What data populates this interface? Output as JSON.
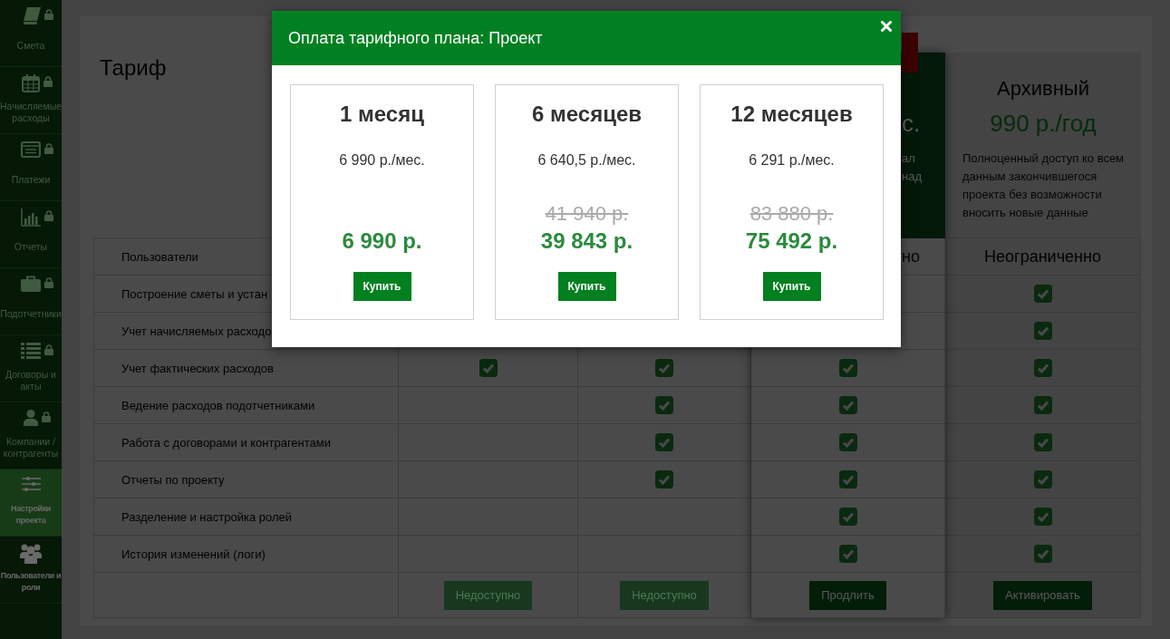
{
  "sidebar": {
    "items": [
      {
        "label": "Смета",
        "locked": true,
        "selected": false
      },
      {
        "label": "Начисляемые расходы",
        "locked": true,
        "selected": false
      },
      {
        "label": "Платежи",
        "locked": true,
        "selected": false
      },
      {
        "label": "Отчеты",
        "locked": true,
        "selected": false
      },
      {
        "label": "Подотчетники",
        "locked": true,
        "selected": false
      },
      {
        "label": "Договоры и акты",
        "locked": true,
        "selected": false
      },
      {
        "label": "Компании / контрагенты",
        "locked": true,
        "selected": false
      },
      {
        "label": "Настройки проекта",
        "locked": false,
        "selected": true
      },
      {
        "label": "Пользователи и роли",
        "locked": false,
        "selected": false
      }
    ]
  },
  "page": {
    "title": "Тариф"
  },
  "tariff_table": {
    "plans": [
      {
        "kind": "regular",
        "button": {
          "label": "Недоступно",
          "disabled": true
        }
      },
      {
        "kind": "regular",
        "button": {
          "label": "Недоступно",
          "disabled": true
        }
      },
      {
        "kind": "current",
        "header": {
          "price": "с.",
          "description_lines": [
            "ал",
            "над"
          ]
        },
        "button": {
          "label": "Продлить",
          "disabled": false
        }
      },
      {
        "kind": "archive",
        "header": {
          "name": "Архивный",
          "price": "990 р./год",
          "description": "Полноценный доступ ко всем данным закончившегося проекта без возможности вносить новые данные"
        },
        "button": {
          "label": "Активировать",
          "disabled": false
        }
      }
    ],
    "rows": [
      {
        "feature": "Пользователи",
        "cells": [
          null,
          null,
          {
            "kind": "text",
            "text": "но"
          },
          {
            "kind": "text",
            "text": "Неограниченно"
          }
        ]
      },
      {
        "feature": "Построение сметы и устан",
        "cells": [
          null,
          null,
          null,
          {
            "kind": "check",
            "checked": true
          }
        ]
      },
      {
        "feature": "Учет начисляемых расходо",
        "cells": [
          null,
          null,
          null,
          {
            "kind": "check",
            "checked": true
          }
        ]
      },
      {
        "feature": "Учет фактических расходов",
        "cells": [
          {
            "kind": "check",
            "checked": true
          },
          {
            "kind": "check",
            "checked": true
          },
          {
            "kind": "check",
            "checked": true
          },
          {
            "kind": "check",
            "checked": true
          }
        ]
      },
      {
        "feature": "Ведение расходов подотчетниками",
        "cells": [
          {
            "kind": "check",
            "checked": false
          },
          {
            "kind": "check",
            "checked": true
          },
          {
            "kind": "check",
            "checked": true
          },
          {
            "kind": "check",
            "checked": true
          }
        ]
      },
      {
        "feature": "Работа с договорами и контрагентами",
        "cells": [
          {
            "kind": "check",
            "checked": false
          },
          {
            "kind": "check",
            "checked": true
          },
          {
            "kind": "check",
            "checked": true
          },
          {
            "kind": "check",
            "checked": true
          }
        ]
      },
      {
        "feature": "Отчеты по проекту",
        "cells": [
          {
            "kind": "check",
            "checked": false
          },
          {
            "kind": "check",
            "checked": true
          },
          {
            "kind": "check",
            "checked": true
          },
          {
            "kind": "check",
            "checked": true
          }
        ]
      },
      {
        "feature": "Разделение и настройка ролей",
        "cells": [
          {
            "kind": "check",
            "checked": false
          },
          {
            "kind": "check",
            "checked": false
          },
          {
            "kind": "check",
            "checked": true
          },
          {
            "kind": "check",
            "checked": true
          }
        ]
      },
      {
        "feature": "История изменений (логи)",
        "cells": [
          {
            "kind": "check",
            "checked": false
          },
          {
            "kind": "check",
            "checked": false
          },
          {
            "kind": "check",
            "checked": true
          },
          {
            "kind": "check",
            "checked": true
          }
        ]
      }
    ]
  },
  "modal": {
    "title": "Оплата тарифного плана: Проект",
    "options": [
      {
        "period": "1 месяц",
        "monthly": "6 990 р./мес.",
        "total": "6 990 р.",
        "button": "Купить"
      },
      {
        "period": "6 месяцев",
        "monthly": "6 640,5 р./мес.",
        "old_total": "41 940 р.",
        "total": "39 843 р.",
        "button": "Купить"
      },
      {
        "period": "12 месяцев",
        "monthly": "6 291 р./мес.",
        "old_total": "83 880 р.",
        "total": "75 492 р.",
        "button": "Купить"
      }
    ]
  }
}
